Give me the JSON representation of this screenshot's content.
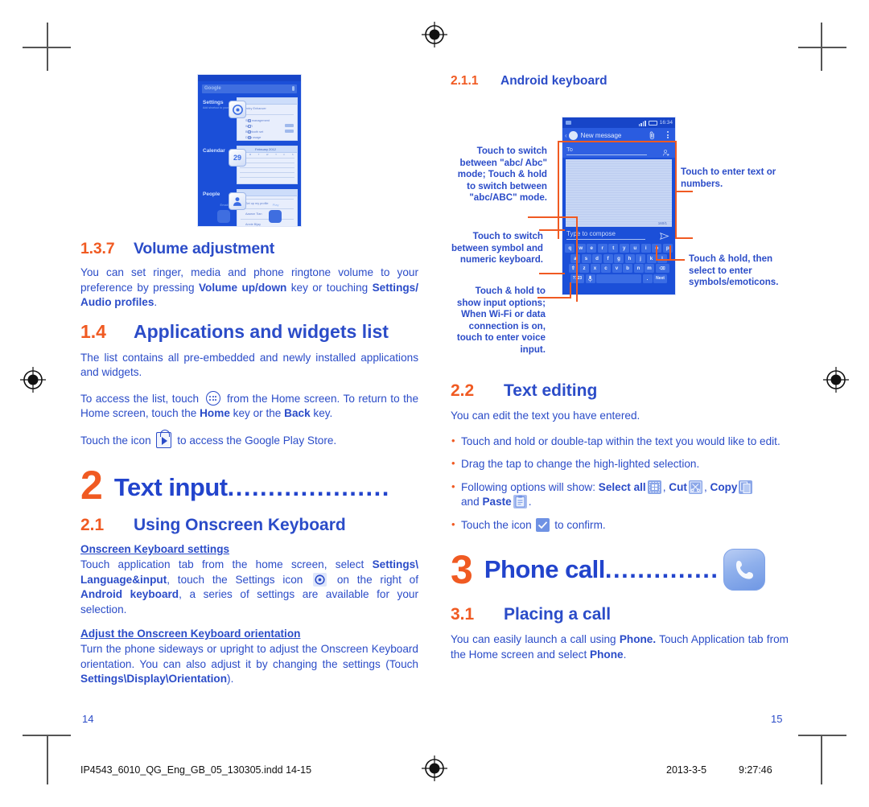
{
  "document": {
    "left_page_number": "14",
    "right_page_number": "15",
    "footer_filename": "IP4543_6010_QG_Eng_GB_05_130305.indd   14-15",
    "footer_date": "2013-3-5",
    "footer_time": "9:27:46"
  },
  "left_column": {
    "s137": {
      "num": "1.3.7",
      "title": "Volume adjustment",
      "para_1a": "You can set ringer, media and phone ringtone volume to your preference by pressing ",
      "para_1b": "Volume up/down",
      "para_1c": " key or touching ",
      "para_1d": "Settings/ Audio profiles",
      "para_1e": "."
    },
    "s14": {
      "num": "1.4",
      "title": "Applications and widgets list",
      "para_1": "The list contains all pre-embedded and newly installed applications and widgets.",
      "para_2a": "To access the list, touch ",
      "para_2b": " from the Home screen. To return to the Home screen, touch the ",
      "para_2c": "Home",
      "para_2d": " key or the ",
      "para_2e": "Back",
      "para_2f": " key.",
      "para_3a": "Touch the icon ",
      "para_3b": " to access the Google Play Store."
    },
    "chapter2": {
      "number": "2",
      "title": "Text input",
      "dots": "...................."
    },
    "s21": {
      "num": "2.1",
      "title": "Using Onscreen Keyboard",
      "sub_1": "Onscreen Keyboard settings",
      "p1a": "Touch application tab from the home screen, select ",
      "p1b": "Settings\\ Language&input",
      "p1c": ", touch the Settings icon ",
      "p1d": " on the right of ",
      "p1e": "Android keyboard",
      "p1f": ", a series of settings are available for your selection.",
      "sub_2": "Adjust the Onscreen Keyboard orientation",
      "p2a": "Turn the phone sideways or upright to adjust the Onscreen Keyboard orientation. You can also adjust it by changing the settings (Touch ",
      "p2b": "Settings\\Display\\Orientation",
      "p2c": ")."
    },
    "phone_shot": {
      "search_placeholder": "Google",
      "rows": [
        {
          "label": "Settings",
          "sub": "Add shortcut to your phone settings"
        },
        {
          "label": "Calendar",
          "sub": ""
        },
        {
          "label": "People",
          "sub": ""
        }
      ],
      "settings_items": [
        "Settings",
        "entry Enhancer",
        "SIM management",
        "Wi-Fi",
        "Bluetooth set",
        "Data usage"
      ],
      "calendar_title": "February 2012",
      "calendar_badge": "29",
      "people_items": [
        "Set up my profile",
        "Aaaron Tian",
        "Annie Bijay"
      ],
      "dock_labels": [
        "Email",
        "Play"
      ]
    }
  },
  "right_column": {
    "s211": {
      "num": "2.1.1",
      "title": "Android keyboard"
    },
    "callouts": {
      "left_top": "Touch to switch between \"abc/ Abc\" mode; Touch & hold to switch between \"abc/ABC\" mode.",
      "right_top": "Touch to enter text or numbers.",
      "left_mid": "Touch to switch between symbol and numeric keyboard.",
      "right_mid": "Touch & hold, then select to enter symbols/emoticons.",
      "left_bottom": "Touch & hold to show input options; When Wi-Fi or data connection is on, touch to enter voice input."
    },
    "phone": {
      "status_time": "16:34",
      "title": "New message",
      "to_placeholder": "To",
      "char_count": "160/1",
      "compose_placeholder": "Type to compose",
      "keys_row1": [
        "q",
        "w",
        "e",
        "r",
        "t",
        "y",
        "u",
        "i",
        "o",
        "p"
      ],
      "keys_row2": [
        "a",
        "s",
        "d",
        "f",
        "g",
        "h",
        "j",
        "k",
        "l"
      ],
      "keys_row3": [
        "z",
        "x",
        "c",
        "v",
        "b",
        "n",
        "m"
      ],
      "key_shift": "⇧",
      "key_delete": "⌫",
      "key_sym": "?123",
      "key_mic": "🎤",
      "key_period": ".",
      "key_next": "Next"
    },
    "s22": {
      "num": "2.2",
      "title": "Text editing",
      "intro": "You can edit the text you have entered.",
      "b1": "Touch and hold or double-tap within the text you would like to edit.",
      "b2": "Drag the tap to change the high-lighted selection.",
      "b3a": "Following options will show: ",
      "b3_selectall": "Select all",
      "b3_cut": "Cut",
      "b3_copy": "Copy",
      "b3_and": "and ",
      "b3_paste": "Paste",
      "b3_end": ".",
      "b4a": "Touch the icon ",
      "b4b": " to confirm."
    },
    "chapter3": {
      "number": "3",
      "title": "Phone call",
      "dots": ".............."
    },
    "s31": {
      "num": "3.1",
      "title": "Placing a call",
      "p1a": "You can easily launch a call using ",
      "p1b": "Phone.",
      "p1c": " Touch Application tab from the Home screen and select ",
      "p1d": "Phone",
      "p1e": "."
    }
  },
  "colors": {
    "accent_orange": "#f05a22",
    "heading_blue": "#2b4cc8",
    "body_blue": "#2b4cc8",
    "phone_blue": "#1b4fd8"
  }
}
